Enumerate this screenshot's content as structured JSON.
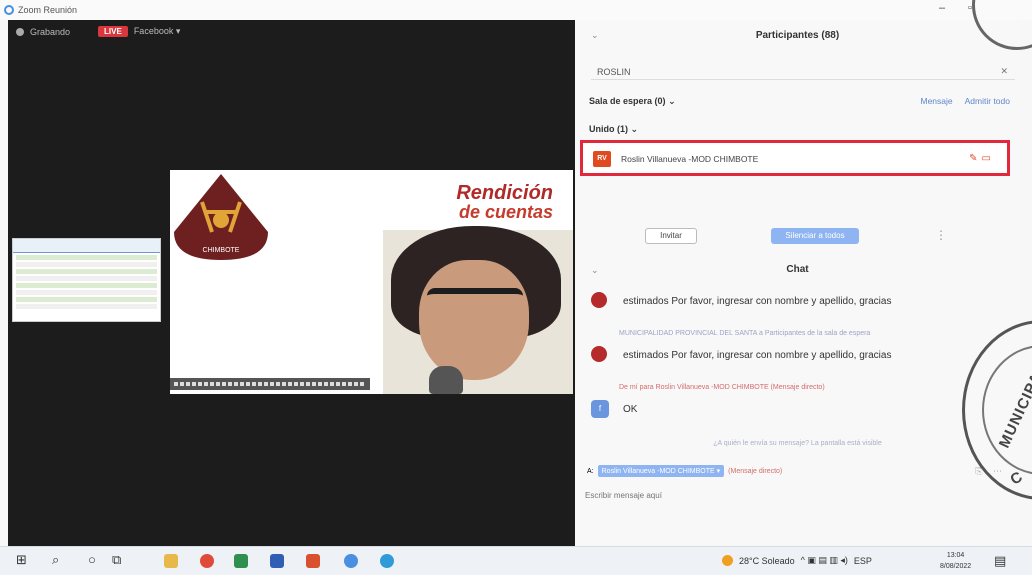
{
  "window": {
    "title": "Zoom Reunión",
    "minimize_label": "–",
    "restore_label": "▫"
  },
  "stamp": {
    "word": "MUNICIPA",
    "letter": "C"
  },
  "video": {
    "recording_label": "Grabando",
    "live_label": "LIVE",
    "stream_label": "Facebook ▾",
    "slide_headline_line1": "Rendición",
    "slide_headline_line2": "de cuentas",
    "logo_text": "CHIMBOTE"
  },
  "participants": {
    "title": "Participantes (88)",
    "search_value": "ROSLIN",
    "waiting_label": "Sala de espera (0)",
    "waiting_message_label": "Mensaje",
    "waiting_admit_all_label": "Admitir todo",
    "joined_label": "Unido (1)",
    "list": [
      {
        "initials": "RV",
        "name": "Roslin Villanueva -MOD CHIMBOTE"
      }
    ],
    "invite_label": "Invitar",
    "mute_all_label": "Silenciar a todos"
  },
  "chat": {
    "title": "Chat",
    "messages": [
      {
        "meta": "",
        "text": "estimados Por favor, ingresar con nombre y apellido, gracias"
      },
      {
        "meta": "MUNICIPALIDAD PROVINCIAL DEL SANTA a Participantes de la sala de espera",
        "text": "estimados Por favor, ingresar con nombre y apellido, gracias"
      },
      {
        "meta": "De mí para Roslin Villanueva -MOD CHIMBOTE (Mensaje directo)",
        "text": "OK"
      }
    ],
    "notice": "¿A quién le envía su mensaje? La pantalla está visible",
    "to_prefix": "A:",
    "recipient": "Roslin Villanueva -MOD CHIMBOTE ▾",
    "direct_label": "(Mensaje directo)",
    "input_placeholder": "Escribir mensaje aquí"
  },
  "taskbar": {
    "weather": "28°C Soleado",
    "language": "ESP",
    "time": "13:04",
    "date": "8/08/2022"
  },
  "colors": {
    "highlight": "#e02a3c",
    "live": "#d9363e",
    "zoom_blue": "#8fb4f2"
  }
}
